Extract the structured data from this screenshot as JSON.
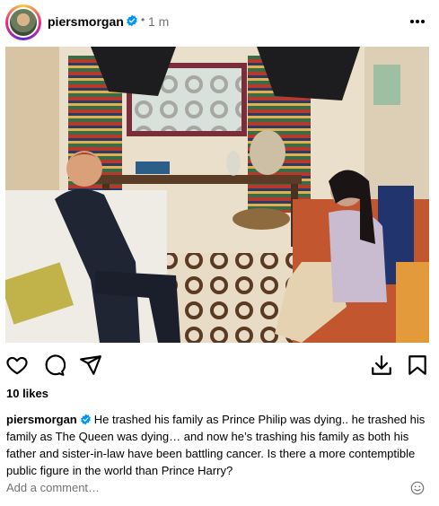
{
  "post": {
    "username": "piersmorgan",
    "dot": "•",
    "time": "1 m",
    "likes": "10 likes",
    "caption_user": "piersmorgan",
    "caption_text": "He trashed his family as Prince Philip was dying.. he trashed his family as The Queen was dying… and now he’s trashing his family as both his father and sister-in-law have been battling cancer. Is there a more contemptible public figure in the world than Prince Harry?",
    "comment_placeholder": "Add a comment…"
  },
  "icons": {
    "verified": "verified-badge-icon",
    "more": "more-options-icon",
    "like": "heart-icon",
    "comment": "comment-icon",
    "share": "paper-plane-icon",
    "download": "download-icon",
    "save": "bookmark-icon",
    "emoji": "emoji-icon"
  },
  "colors": {
    "verified": "#0095f6",
    "muted": "#737373"
  }
}
